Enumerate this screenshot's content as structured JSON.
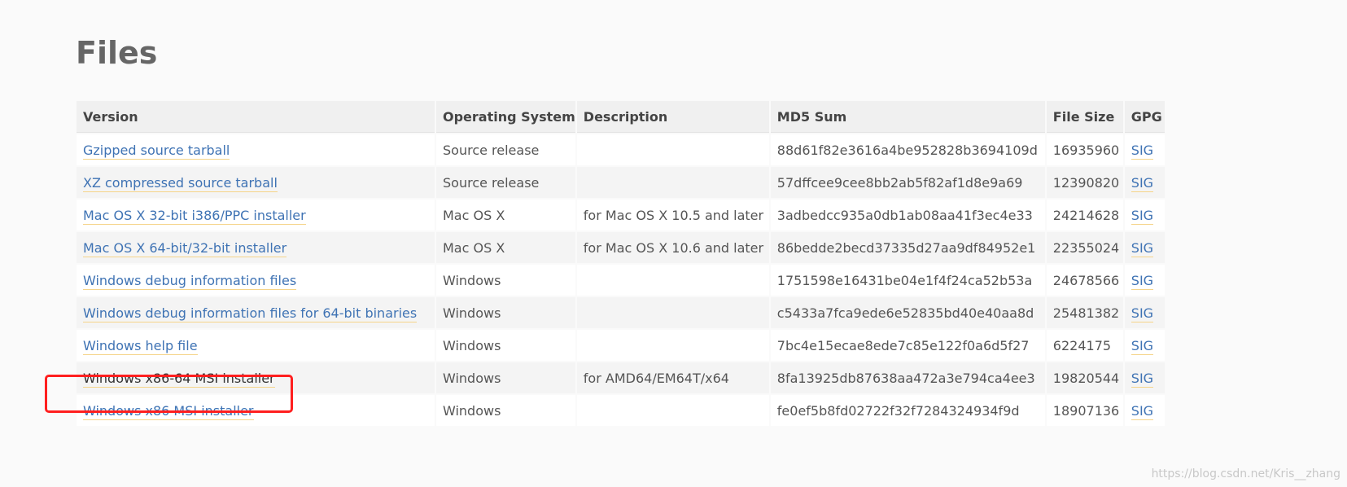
{
  "page": {
    "title": "Files"
  },
  "table": {
    "headers": {
      "version": "Version",
      "os": "Operating System",
      "description": "Description",
      "md5": "MD5 Sum",
      "size": "File Size",
      "gpg": "GPG"
    },
    "rows": [
      {
        "version": "Gzipped source tarball",
        "os": "Source release",
        "description": "",
        "md5": "88d61f82e3616a4be952828b3694109d",
        "size": "16935960",
        "gpg": "SIG"
      },
      {
        "version": "XZ compressed source tarball",
        "os": "Source release",
        "description": "",
        "md5": "57dffcee9cee8bb2ab5f82af1d8e9a69",
        "size": "12390820",
        "gpg": "SIG"
      },
      {
        "version": "Mac OS X 32-bit i386/PPC installer",
        "os": "Mac OS X",
        "description": "for Mac OS X 10.5 and later",
        "md5": "3adbedcc935a0db1ab08aa41f3ec4e33",
        "size": "24214628",
        "gpg": "SIG"
      },
      {
        "version": "Mac OS X 64-bit/32-bit installer",
        "os": "Mac OS X",
        "description": "for Mac OS X 10.6 and later",
        "md5": "86bedde2becd37335d27aa9df84952e1",
        "size": "22355024",
        "gpg": "SIG"
      },
      {
        "version": "Windows debug information files",
        "os": "Windows",
        "description": "",
        "md5": "1751598e16431be04e1f4f24ca52b53a",
        "size": "24678566",
        "gpg": "SIG"
      },
      {
        "version": "Windows debug information files for 64-bit binaries",
        "os": "Windows",
        "description": "",
        "md5": "c5433a7fca9ede6e52835bd40e40aa8d",
        "size": "25481382",
        "gpg": "SIG"
      },
      {
        "version": "Windows help file",
        "os": "Windows",
        "description": "",
        "md5": "7bc4e15ecae8ede7c85e122f0a6d5f27",
        "size": "6224175",
        "gpg": "SIG"
      },
      {
        "version": "Windows x86-64 MSI installer",
        "os": "Windows",
        "description": "for AMD64/EM64T/x64",
        "md5": "8fa13925db87638aa472a3e794ca4ee3",
        "size": "19820544",
        "gpg": "SIG"
      },
      {
        "version": "Windows x86 MSI installer",
        "os": "Windows",
        "description": "",
        "md5": "fe0ef5b8fd02722f32f7284324934f9d",
        "size": "18907136",
        "gpg": "SIG"
      }
    ]
  },
  "watermark": "https://blog.csdn.net/Kris__zhang",
  "colors": {
    "link": "#3f73b4",
    "link_underline": "#f5d48a",
    "highlight": "#ff1f1f"
  }
}
